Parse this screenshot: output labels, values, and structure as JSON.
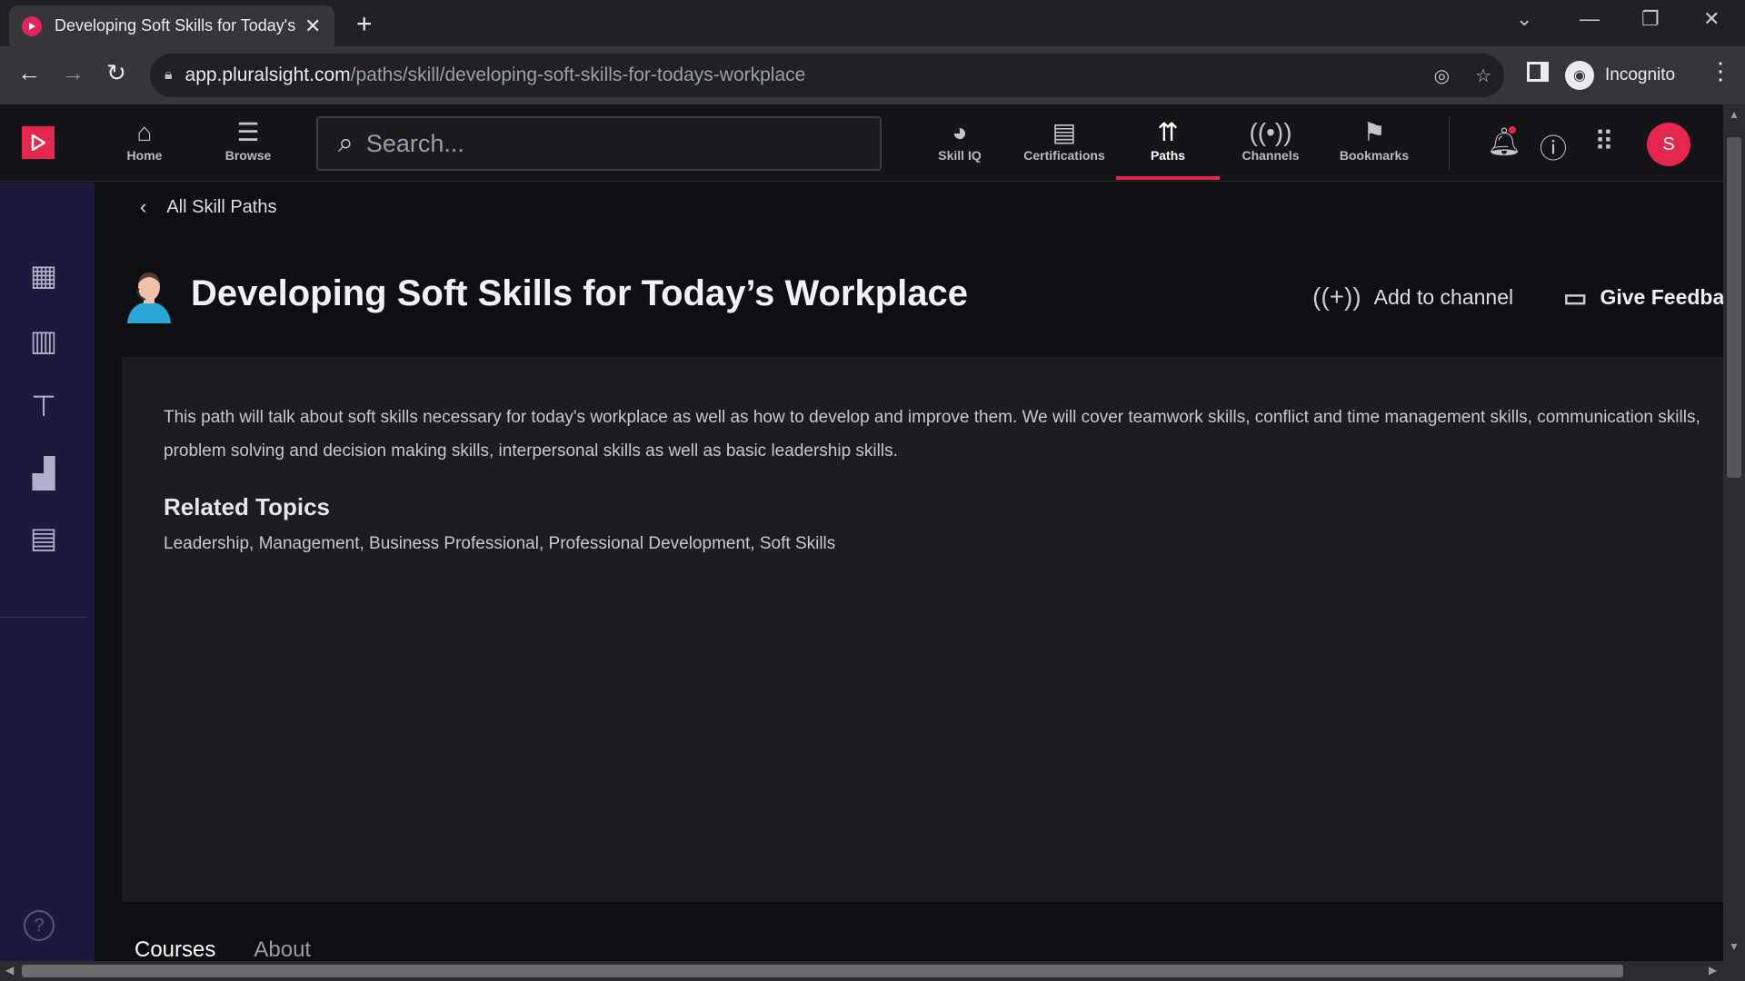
{
  "browser": {
    "tab_title": "Developing Soft Skills for Today's",
    "url_host": "app.pluralsight.com",
    "url_path": "/paths/skill/developing-soft-skills-for-todays-workplace",
    "incognito_label": "Incognito"
  },
  "nav": {
    "home": "Home",
    "browse": "Browse",
    "search_placeholder": "Search...",
    "skill_iq": "Skill IQ",
    "certifications": "Certifications",
    "paths": "Paths",
    "channels": "Channels",
    "bookmarks": "Bookmarks",
    "avatar_initial": "S"
  },
  "page": {
    "back_label": "All Skill Paths",
    "title": "Developing Soft Skills for Today’s Workplace",
    "add_to_channel": "Add to channel",
    "give_feedback": "Give Feedbac",
    "description": "This path will talk about soft skills necessary for today's workplace as well as how to develop and improve them. We will cover teamwork skills, conflict and time management skills, communication skills, problem solving and decision making skills, interpersonal skills as well as basic leadership skills.",
    "related_heading": "Related Topics",
    "related_topics": "Leadership, Management, Business Professional, Professional Development, Soft Skills",
    "tabs": [
      "Courses",
      "About"
    ]
  },
  "colors": {
    "brand": "#e5264e",
    "sidebar": "#1c1a3b",
    "panel": "#1b1d21"
  }
}
